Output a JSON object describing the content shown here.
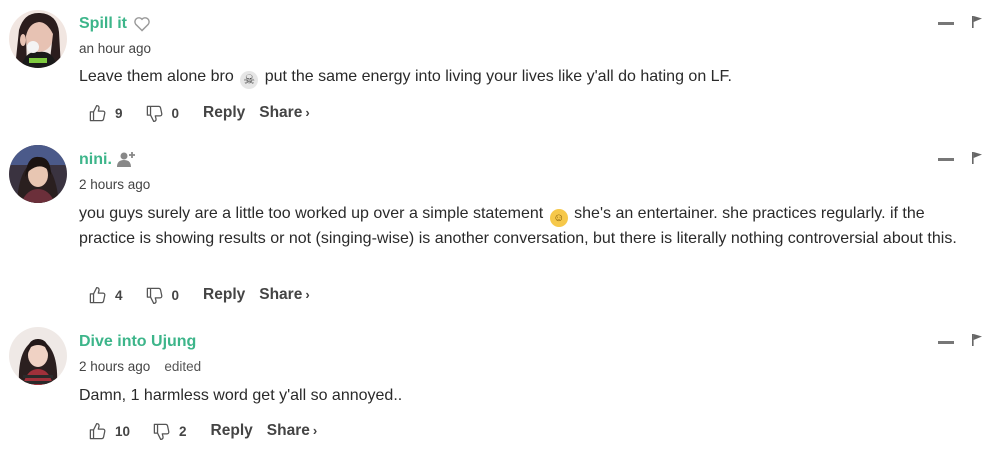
{
  "comments": [
    {
      "author": "Spill it",
      "author_badge_icon": "heart-outline-icon",
      "time": "an hour ago",
      "edited": "",
      "text_before": "Leave them alone bro",
      "emoji": "skull",
      "text_after": "put the same energy into living your lives like y'all do hating on LF.",
      "likes": "9",
      "dislikes": "0",
      "reply_label": "Reply",
      "share_label": "Share",
      "accent": "#3db58a"
    },
    {
      "author": "nini.",
      "author_badge_icon": "add-user-icon",
      "time": "2 hours ago",
      "edited": "",
      "text_before": "you guys surely are a little too worked up over a simple statement",
      "emoji": "grimacing-face",
      "text_after": "she's an entertainer. she practices regularly. if the practice is showing results or not (singing-wise) is another conversation, but there is literally nothing controversial about this.",
      "likes": "4",
      "dislikes": "0",
      "reply_label": "Reply",
      "share_label": "Share",
      "accent": "#3db58a"
    },
    {
      "author": "Dive into Ujung",
      "author_badge_icon": "",
      "time": "2 hours ago",
      "edited": "edited",
      "text_before": "Damn, 1 harmless word get y'all so annoyed..",
      "emoji": "",
      "text_after": "",
      "likes": "10",
      "dislikes": "2",
      "reply_label": "Reply",
      "share_label": "Share",
      "accent": "#3db58a"
    }
  ]
}
